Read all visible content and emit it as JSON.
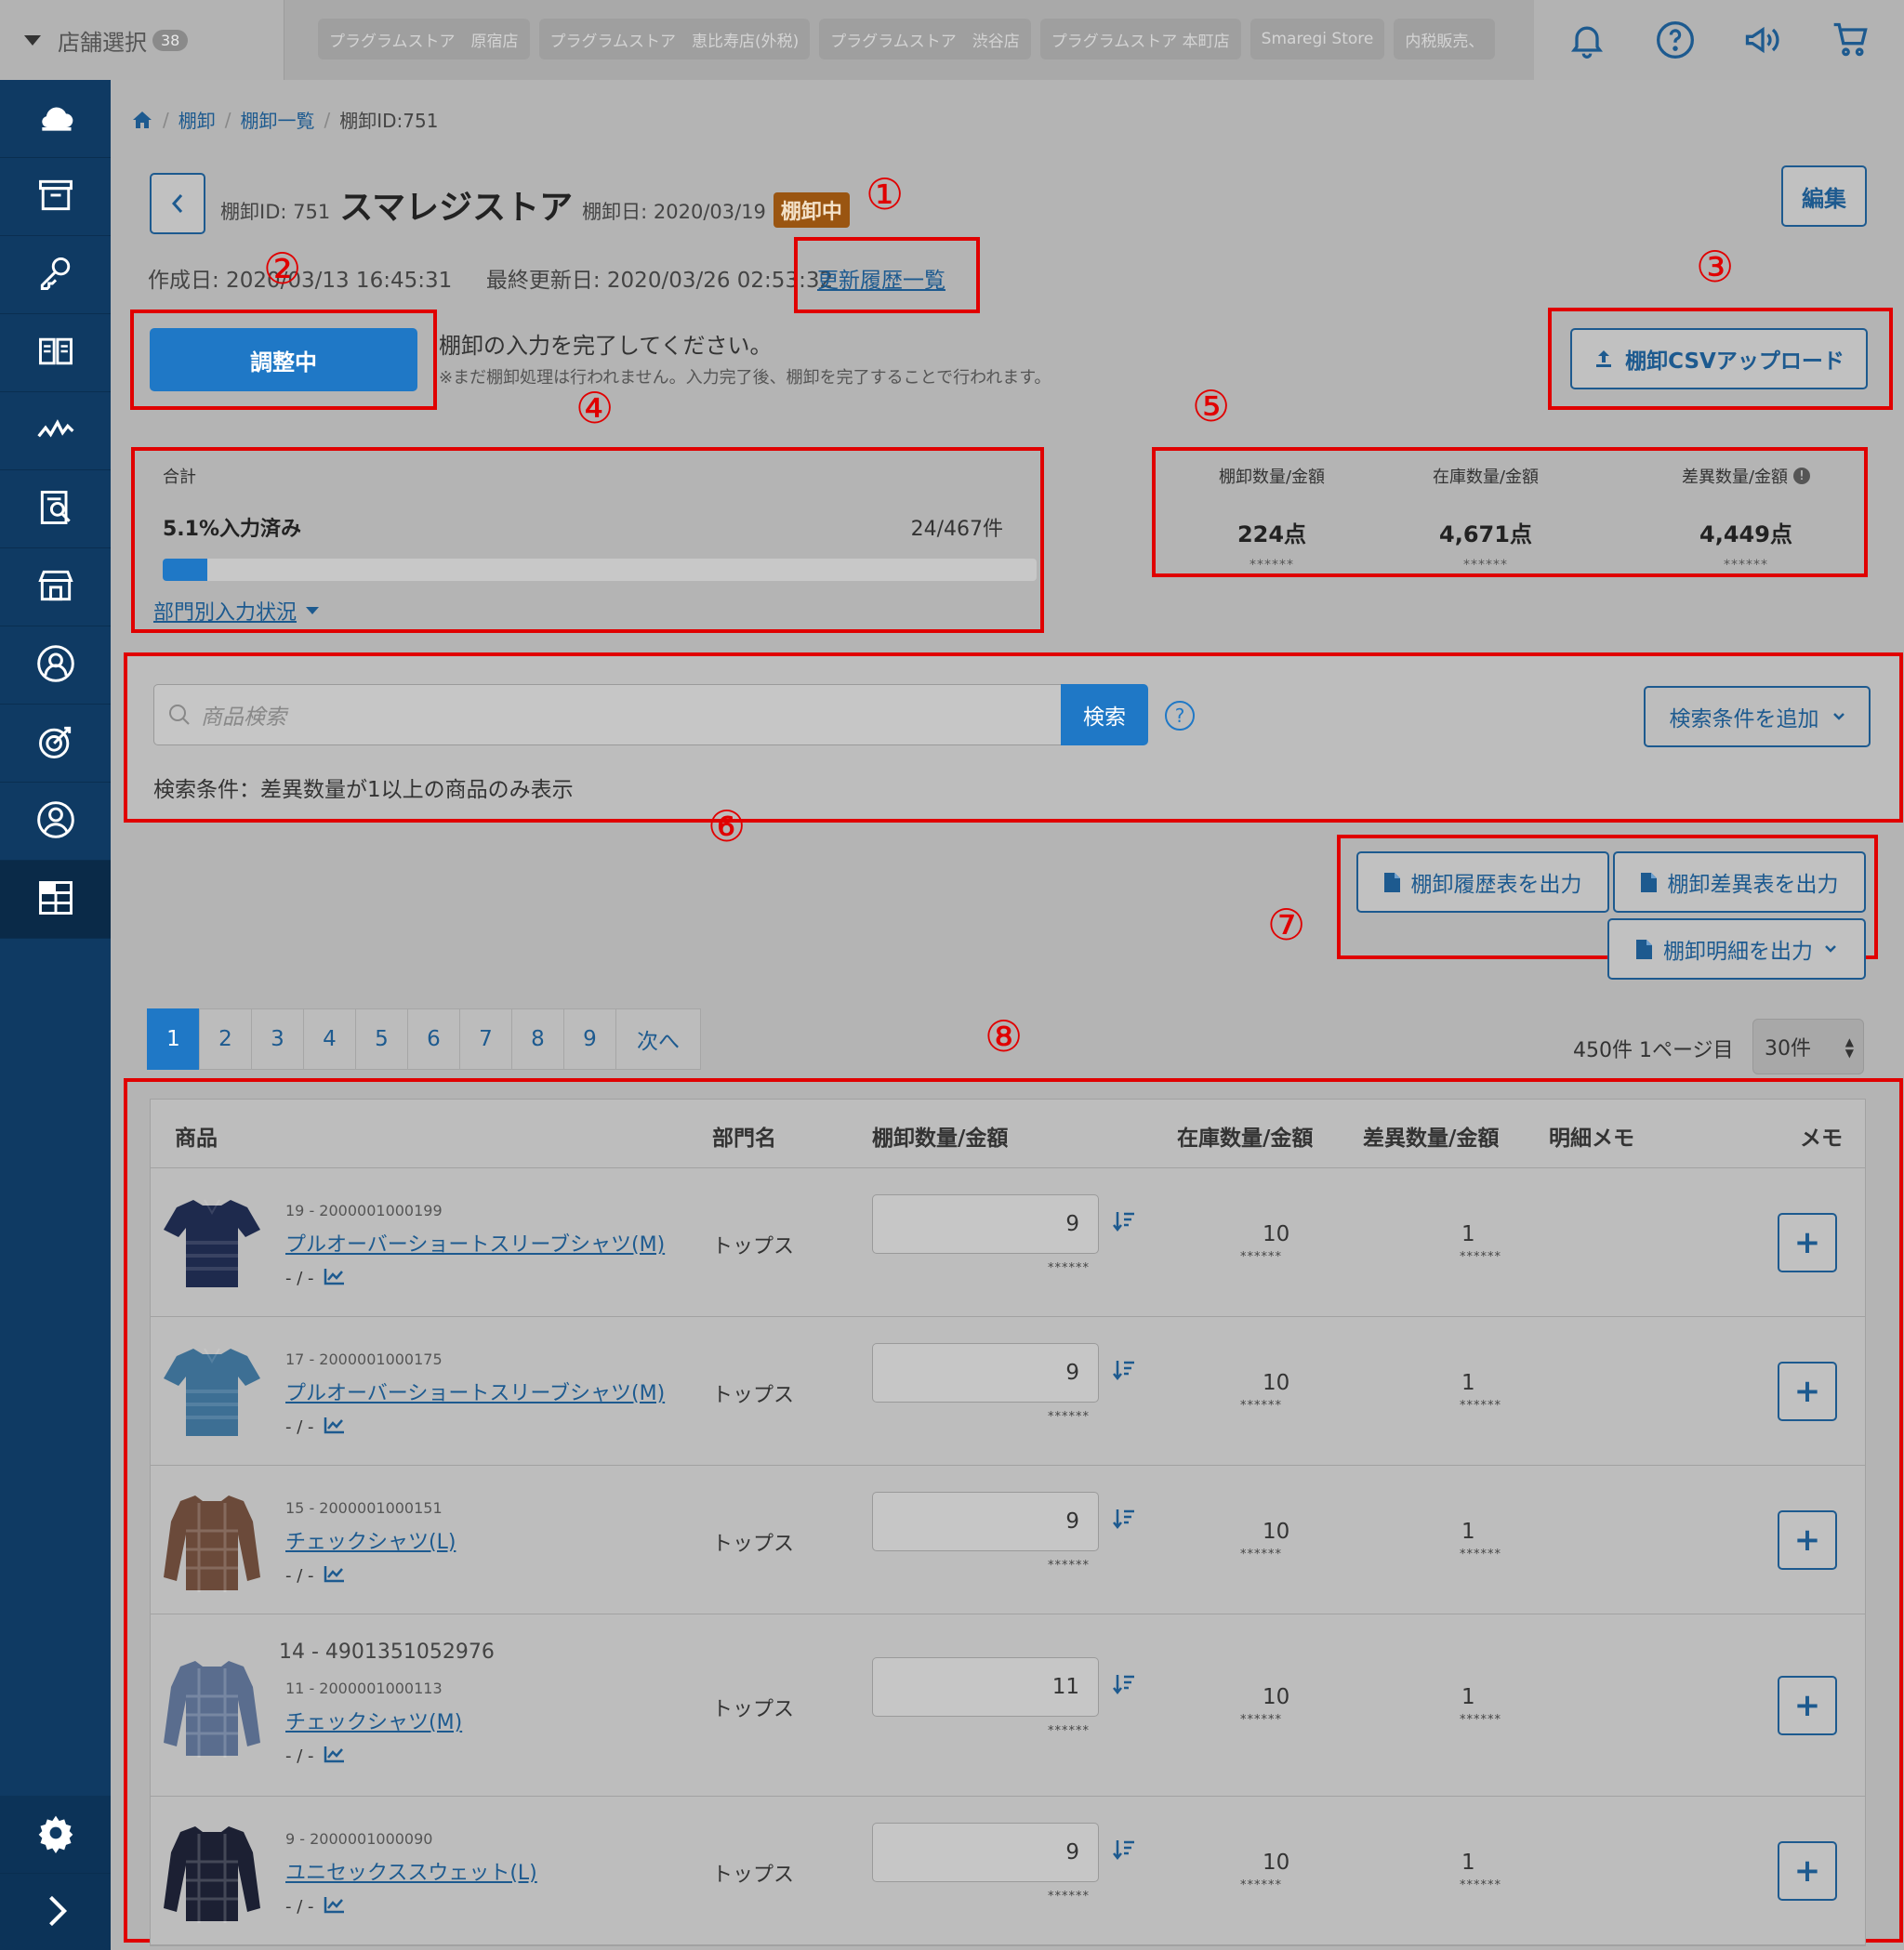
{
  "topbar": {
    "store_select_label": "店舗選択",
    "store_count": "38",
    "store_tabs": [
      "プラグラムストア　原宿店",
      "プラグラムストア　恵比寿店(外税)",
      "プラグラムストア　渋谷店",
      "プラグラムストア 本町店",
      "Smaregi Store",
      "内税販売、"
    ],
    "icons": [
      "bell-icon",
      "help-icon",
      "megaphone-icon",
      "cart-icon"
    ]
  },
  "sidebar": {
    "icons": [
      "cloud-icon",
      "archive-icon",
      "key-icon",
      "book-icon",
      "chart-icon",
      "report-icon",
      "store-icon",
      "customer-icon",
      "target-icon",
      "user-icon",
      "inventory-icon",
      "settings-icon",
      "expand-icon"
    ]
  },
  "breadcrumb": {
    "items": [
      "棚卸",
      "棚卸一覧"
    ],
    "current": "棚卸ID:751"
  },
  "header": {
    "id_label": "棚卸ID: 751",
    "store_name": "スマレジストア",
    "date_label": "棚卸日: 2020/03/19",
    "status": "棚卸中",
    "edit_label": "編集",
    "created": "作成日: 2020/03/13 16:45:31",
    "updated": "最終更新日: 2020/03/26 02:53:32",
    "history_link": "更新履歴一覧"
  },
  "markers": [
    "①",
    "②",
    "③",
    "④",
    "⑤",
    "⑥",
    "⑦",
    "⑧"
  ],
  "action": {
    "adjust_label": "調整中",
    "message": "棚卸の入力を完了してください。",
    "note": "※まだ棚卸処理は行われません。入力完了後、棚卸を完了することで行われます。",
    "csv_upload_label": "棚卸CSVアップロード"
  },
  "summary": {
    "label": "合計",
    "percent_text": "5.1%入力済み",
    "count_text": "24/467件",
    "progress": 0.051,
    "dept_link": "部門別入力状況"
  },
  "quantities": [
    {
      "header": "棚卸数量/金額",
      "value": "224点",
      "sub": "******"
    },
    {
      "header": "在庫数量/金額",
      "value": "4,671点",
      "sub": "******"
    },
    {
      "header": "差異数量/金額",
      "value": "4,449点",
      "sub": "******"
    }
  ],
  "search": {
    "placeholder": "商品検索",
    "button": "検索",
    "help": "?",
    "add_condition": "検索条件を追加",
    "condition_text": "検索条件：差異数量が1以上の商品のみ表示"
  },
  "outputs": {
    "history": "棚卸履歴表を出力",
    "diff": "棚卸差異表を出力",
    "detail": "棚卸明細を出力"
  },
  "pager": {
    "pages": [
      "1",
      "2",
      "3",
      "4",
      "5",
      "6",
      "7",
      "8",
      "9"
    ],
    "next": "次へ",
    "info": "450件 1ページ目",
    "per_page": "30件"
  },
  "table": {
    "headers": {
      "product": "商品",
      "dept": "部門名",
      "count": "棚卸数量/金額",
      "stock": "在庫数量/金額",
      "diff": "差異数量/金額",
      "memo_detail": "明細メモ",
      "memo": "メモ"
    },
    "rows": [
      {
        "code_extra": "",
        "code": "19 - 2000001000199",
        "name": "プルオーバーショートスリーブシャツ(M)",
        "meta": "- / -",
        "dept": "トップス",
        "qty": "9",
        "qty_sub": "******",
        "stock": "10",
        "stock_sub": "******",
        "diff": "1",
        "diff_sub": "******",
        "plus": "+",
        "color": "#1e2a4d",
        "kind": "shirt"
      },
      {
        "code_extra": "",
        "code": "17 - 2000001000175",
        "name": "プルオーバーショートスリーブシャツ(M)",
        "meta": "- / -",
        "dept": "トップス",
        "qty": "9",
        "qty_sub": "******",
        "stock": "10",
        "stock_sub": "******",
        "diff": "1",
        "diff_sub": "******",
        "plus": "+",
        "color": "#3d6f94",
        "kind": "shirt"
      },
      {
        "code_extra": "",
        "code": "15 - 2000001000151",
        "name": "チェックシャツ(L)",
        "meta": "- / -",
        "dept": "トップス",
        "qty": "9",
        "qty_sub": "******",
        "stock": "10",
        "stock_sub": "******",
        "diff": "1",
        "diff_sub": "******",
        "plus": "+",
        "color": "#6b4a3a",
        "kind": "long"
      },
      {
        "code_extra": "14 - 4901351052976",
        "code": "11 - 2000001000113",
        "name": "チェックシャツ(M)",
        "meta": "- / -",
        "dept": "トップス",
        "qty": "11",
        "qty_sub": "******",
        "stock": "10",
        "stock_sub": "******",
        "diff": "1",
        "diff_sub": "******",
        "plus": "+",
        "color": "#5a6d8e",
        "kind": "long"
      },
      {
        "code_extra": "",
        "code": "9 - 2000001000090",
        "name": "ユニセックススウェット(L)",
        "meta": "- / -",
        "dept": "トップス",
        "qty": "9",
        "qty_sub": "******",
        "stock": "10",
        "stock_sub": "******",
        "diff": "1",
        "diff_sub": "******",
        "plus": "+",
        "color": "#1c2033",
        "kind": "long"
      }
    ]
  }
}
